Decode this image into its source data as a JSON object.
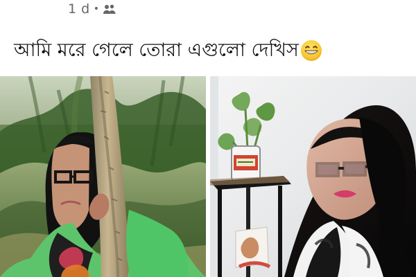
{
  "post": {
    "time": "1 d",
    "dot": "•",
    "audience_icon": "friends-icon",
    "caption": "আমি মরে গেলে তোরা এগুলো দেখিস",
    "emoji_icon": "grinning-face-icon"
  },
  "photos": [
    {
      "name": "left-photo",
      "icon": "outdoor-portrait-photo"
    },
    {
      "name": "right-photo",
      "icon": "indoor-selfie-photo"
    }
  ],
  "colors": {
    "meta": "#65676b",
    "caption": "#111111",
    "background": "#ffffff",
    "emoji": "#f7c531"
  }
}
